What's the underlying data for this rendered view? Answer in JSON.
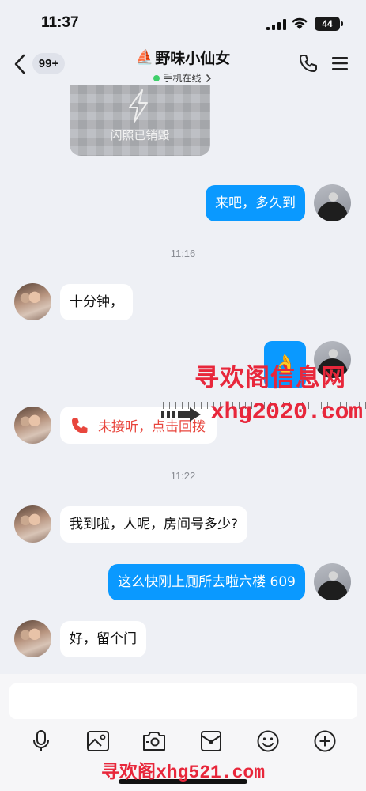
{
  "status_bar": {
    "time": "11:37",
    "battery": "44"
  },
  "header": {
    "unread_count": "99+",
    "title_icon": "⛵",
    "title": "野味小仙女",
    "status": "手机在线",
    "status_color": "#3ecf6a"
  },
  "chat": {
    "flash_photo_label": "闪照已销毁",
    "messages": {
      "m1": "来吧，多久到",
      "m2": "十分钟，",
      "m3": "👌",
      "missed_call": "未接听，点击回拨",
      "m4": "我到啦，人呢，房间号多少?",
      "m5": "这么快刚上厕所去啦六楼 609",
      "m6": "好，留个门"
    },
    "timestamps": {
      "t1": "11:16",
      "t2": "11:22"
    },
    "colors": {
      "outgoing_bubble": "#0a99ff",
      "incoming_bubble": "#ffffff",
      "missed_call_text": "#e8463d"
    }
  },
  "watermarks": {
    "w1": "寻欢阁信息网",
    "w2": "xhg2020.com",
    "w3_cn": "寻欢阁",
    "w3_latin": "xhg521.com"
  },
  "toolbar": {
    "icons": [
      "mic-icon",
      "image-icon",
      "camera-icon",
      "red-envelope-icon",
      "emoji-icon",
      "plus-icon"
    ]
  }
}
